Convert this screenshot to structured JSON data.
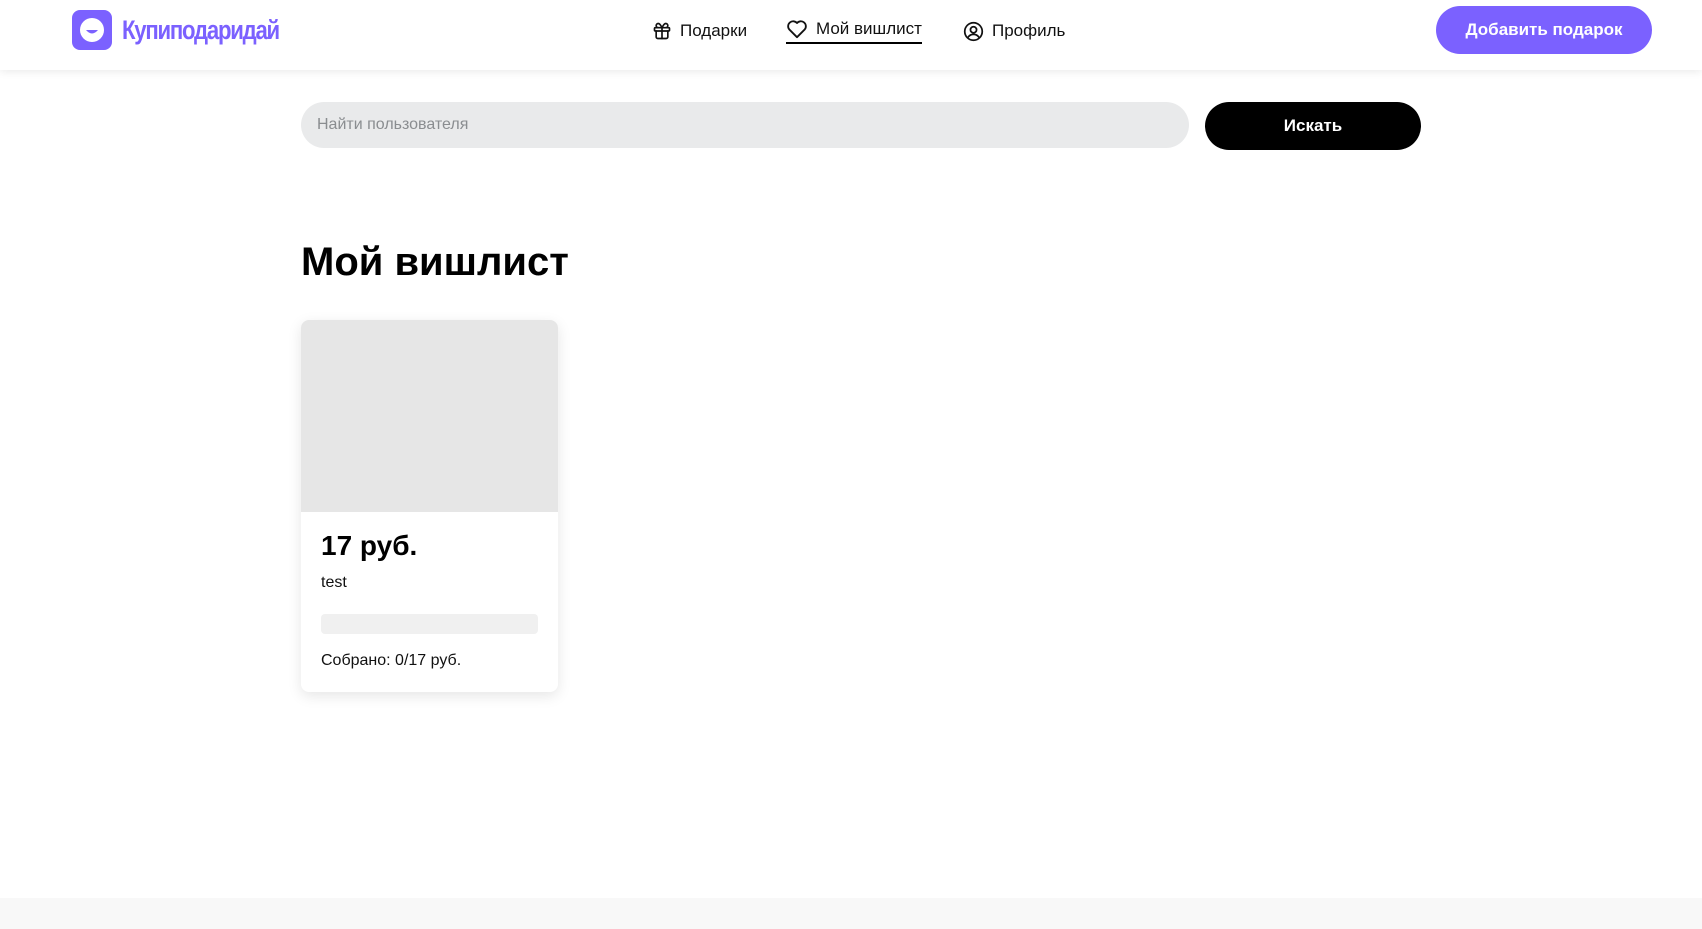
{
  "brand": {
    "name": "Купиподаридай",
    "color": "#7B61FF"
  },
  "nav": {
    "items": [
      {
        "label": "Подарки",
        "icon": "gift-icon"
      },
      {
        "label": "Мой вишлист",
        "icon": "heart-icon",
        "active": true
      },
      {
        "label": "Профиль",
        "icon": "user-circle-icon"
      }
    ]
  },
  "header": {
    "add_button_label": "Добавить подарок"
  },
  "search": {
    "placeholder": "Найти пользователя",
    "value": "",
    "button_label": "Искать"
  },
  "page": {
    "title": "Мой вишлист"
  },
  "wishlist": {
    "items": [
      {
        "price": "17 руб.",
        "name": "test",
        "raised_text": "Собрано: 0/17 руб.",
        "raised_fraction": 0
      }
    ]
  }
}
